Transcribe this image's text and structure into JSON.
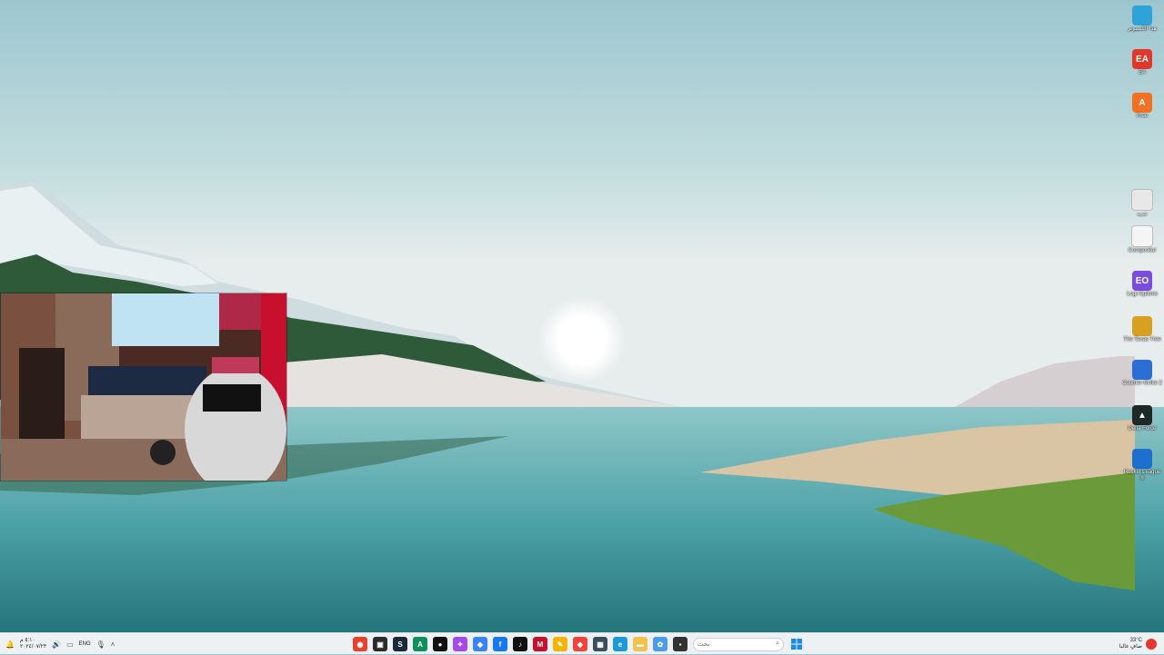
{
  "desktop_icons": [
    {
      "label": "هذا الكمبيوتر",
      "icon": "monitor-icon",
      "color": "#2fa3d8",
      "glyph": ""
    },
    {
      "label": "EA",
      "icon": "ea-app-icon",
      "color": "#e2382b",
      "glyph": "EA"
    },
    {
      "label": "Free",
      "icon": "orange-a-app-icon",
      "color": "#f27022",
      "glyph": "A"
    },
    {
      "label": "جديد",
      "icon": "document-thumbnail-icon",
      "color": "#e8e8e8",
      "glyph": ""
    },
    {
      "label": "Compositor",
      "icon": "blank-file-icon",
      "color": "#f5f5f5",
      "glyph": ""
    },
    {
      "label": "Logi Options",
      "icon": "logi-options-icon",
      "color": "#7b4ce0",
      "glyph": "EO"
    },
    {
      "label": "The Texas Tree",
      "icon": "game-icon",
      "color": "#d8a020",
      "glyph": ""
    },
    {
      "label": "Counter-Strike 2",
      "icon": "counter-strike-icon",
      "color": "#2b6fd6",
      "glyph": ""
    },
    {
      "label": "Delta Force",
      "icon": "delta-force-icon",
      "color": "#1d2a25",
      "glyph": "▲"
    },
    {
      "label": "Rocket League ®",
      "icon": "rocket-league-icon",
      "color": "#1f6fd0",
      "glyph": ""
    }
  ],
  "taskbar": {
    "clock_time": "٥:١٠ م",
    "clock_date": "٢٠٢٤/٠٧/٢٣",
    "language": "ENG",
    "search_placeholder": "بحث",
    "weather_temp": "33°C",
    "weather_desc": "صافٍ غالبا",
    "apps": [
      {
        "name": "chrome-icon",
        "color": "#e5412c",
        "glyph": "◉"
      },
      {
        "name": "terminal-icon",
        "color": "#2b2b2b",
        "glyph": "▣"
      },
      {
        "name": "steam-icon",
        "color": "#1b2838",
        "glyph": "S"
      },
      {
        "name": "android-studio-icon",
        "color": "#0f8f5b",
        "glyph": "A"
      },
      {
        "name": "github-icon",
        "color": "#111111",
        "glyph": "●"
      },
      {
        "name": "messenger-icon",
        "color": "#a34be8",
        "glyph": "✦"
      },
      {
        "name": "shield-vpn-icon",
        "color": "#3a82f7",
        "glyph": "◆"
      },
      {
        "name": "facebook-icon",
        "color": "#1877f2",
        "glyph": "f"
      },
      {
        "name": "tiktok-icon",
        "color": "#111111",
        "glyph": "♪"
      },
      {
        "name": "mcafee-icon",
        "color": "#c8102e",
        "glyph": "M"
      },
      {
        "name": "sticky-notes-icon",
        "color": "#f4b400",
        "glyph": "✎"
      },
      {
        "name": "anydesk-icon",
        "color": "#ef443b",
        "glyph": "◆"
      },
      {
        "name": "calculator-icon",
        "color": "#3b4b5c",
        "glyph": "▦"
      },
      {
        "name": "edge-icon",
        "color": "#1a9ad7",
        "glyph": "e"
      },
      {
        "name": "file-explorer-icon",
        "color": "#f3c24a",
        "glyph": "▬"
      },
      {
        "name": "photos-icon",
        "color": "#4a9be8",
        "glyph": "✿"
      },
      {
        "name": "capture-icon",
        "color": "#333333",
        "glyph": "▪"
      }
    ]
  }
}
